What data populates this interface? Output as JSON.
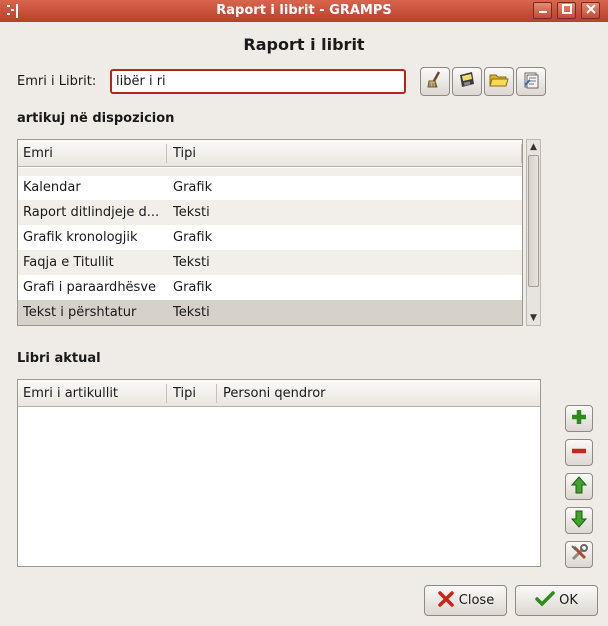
{
  "window": {
    "title": "Raport i librit - GRAMPS",
    "heading": "Raport i librit"
  },
  "book_name": {
    "label": "Emri i Librit:",
    "value": "libër i ri"
  },
  "toolbar": {
    "icons": [
      "clear-broom-icon",
      "save-disk-icon",
      "open-folder-icon",
      "edit-books-icon"
    ]
  },
  "available": {
    "section_title": "artikuj në dispozicion",
    "columns": [
      "Emri",
      "Tipi"
    ],
    "rows": [
      {
        "name": "Kalendar",
        "type": "Grafik"
      },
      {
        "name": "Raport ditlindjeje d...",
        "type": "Teksti"
      },
      {
        "name": "Grafik kronologjik",
        "type": "Grafik"
      },
      {
        "name": "Faqja e Titullit",
        "type": "Teksti"
      },
      {
        "name": "Grafi i paraardhësve",
        "type": "Grafik"
      },
      {
        "name": "Tekst i përshtatur",
        "type": "Teksti"
      }
    ]
  },
  "current": {
    "section_title": "Libri aktual",
    "columns": [
      "Emri i artikullit",
      "Tipi",
      "Personi qendror"
    ]
  },
  "side_buttons": [
    "add-icon",
    "remove-icon",
    "move-up-icon",
    "move-down-icon",
    "configure-tools-icon"
  ],
  "buttons": {
    "close": "Close",
    "ok": "OK"
  }
}
